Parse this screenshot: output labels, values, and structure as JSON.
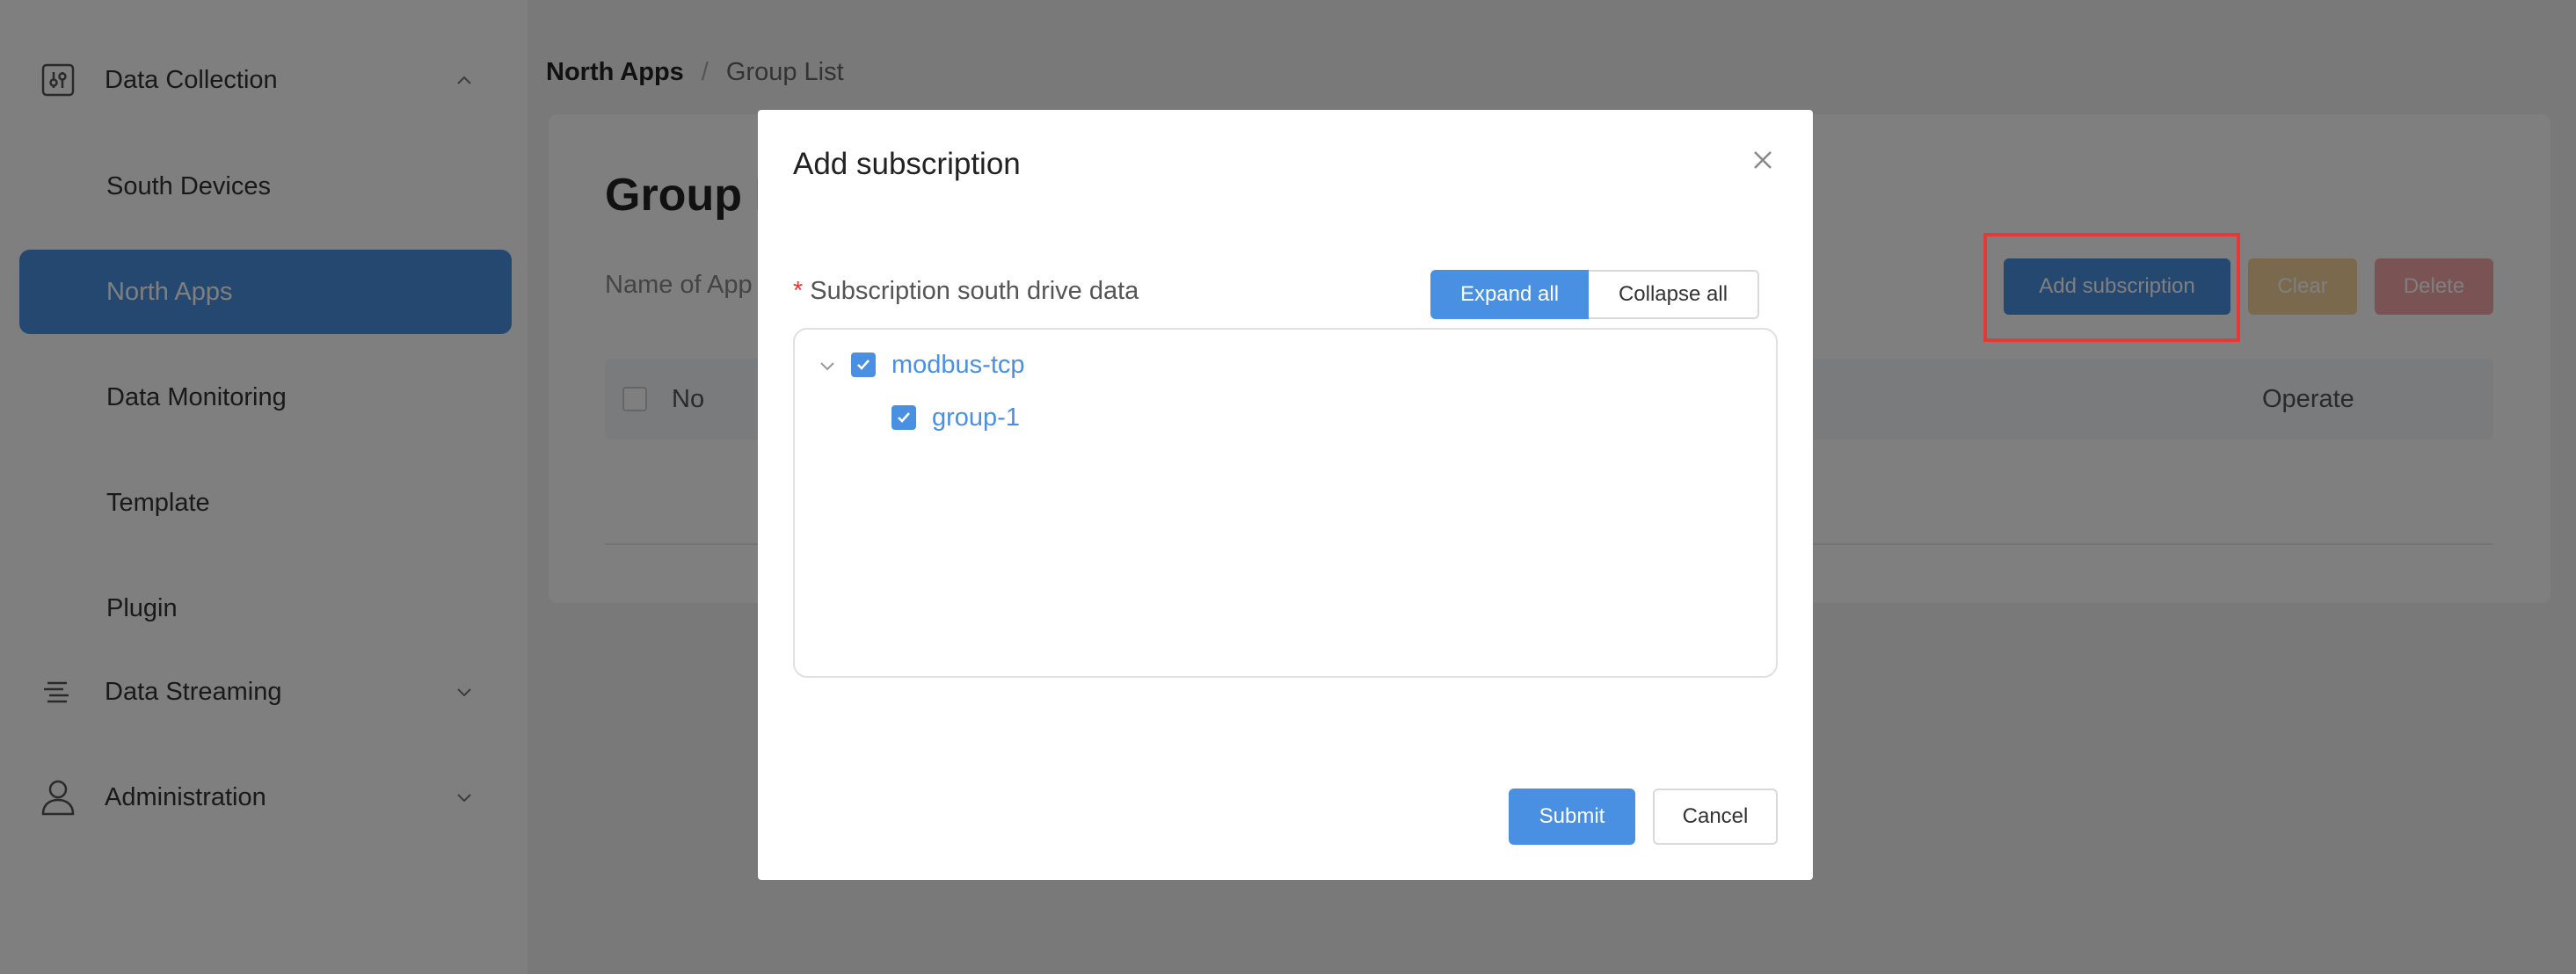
{
  "sidebar": {
    "groups": [
      {
        "label": "Data Collection",
        "icon": "sliders-icon",
        "expanded": true
      },
      {
        "label": "Data Streaming",
        "icon": "streaming-icon",
        "expanded": false
      },
      {
        "label": "Administration",
        "icon": "user-icon",
        "expanded": false
      }
    ],
    "items": [
      {
        "label": "South Devices",
        "active": false
      },
      {
        "label": "North Apps",
        "active": true
      },
      {
        "label": "Data Monitoring",
        "active": false
      },
      {
        "label": "Template",
        "active": false
      },
      {
        "label": "Plugin",
        "active": false
      }
    ]
  },
  "breadcrumb": {
    "first": "North Apps",
    "separator": "/",
    "last": "Group List"
  },
  "card": {
    "title": "Group List",
    "filter_label": "Name of App",
    "buttons": {
      "add": "Add subscription",
      "clear": "Clear",
      "delete": "Delete"
    },
    "table": {
      "col_no": "No",
      "col_operate": "Operate"
    }
  },
  "modal": {
    "title": "Add subscription",
    "field_required_mark": "*",
    "field_label": "Subscription south drive data",
    "expand_all": "Expand all",
    "collapse_all": "Collapse all",
    "tree": {
      "node": {
        "label": "modbus-tcp",
        "checked": true,
        "expanded": true
      },
      "children": [
        {
          "label": "group-1",
          "checked": true
        }
      ]
    },
    "submit": "Submit",
    "cancel": "Cancel"
  },
  "colors": {
    "primary": "#4a90e2",
    "warning": "#f6d29a",
    "danger": "#f4a8a8",
    "highlight": "#e53935"
  }
}
